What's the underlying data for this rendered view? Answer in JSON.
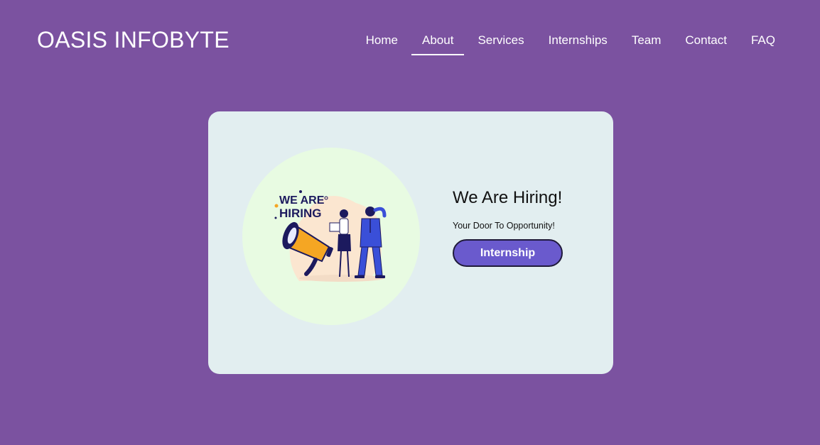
{
  "header": {
    "brand": "OASIS INFOBYTE",
    "nav": [
      {
        "label": "Home",
        "active": false
      },
      {
        "label": "About",
        "active": true
      },
      {
        "label": "Services",
        "active": false
      },
      {
        "label": "Internships",
        "active": false
      },
      {
        "label": "Team",
        "active": false
      },
      {
        "label": "Contact",
        "active": false
      },
      {
        "label": "FAQ",
        "active": false
      }
    ]
  },
  "hero": {
    "image_text": [
      "WE ARE",
      "HIRING"
    ],
    "title": "We Are Hiring!",
    "subtitle": "Your Door To Opportunity!",
    "button_label": "Internship"
  },
  "colors": {
    "background": "#7b52a0",
    "card": "#e2eef0",
    "circle": "#e8fbe2",
    "button": "#6a5acd",
    "megaphone": "#f5a623",
    "navy": "#1c1a5e",
    "suit": "#3a4fd8"
  }
}
